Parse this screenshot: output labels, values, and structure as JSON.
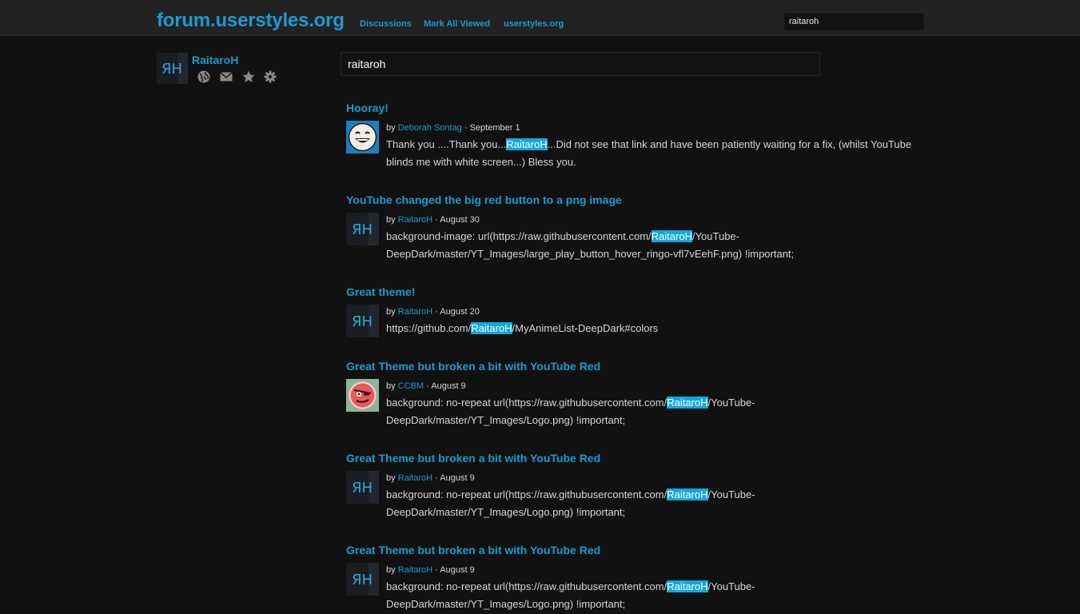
{
  "header": {
    "brand": "forum.userstyles.org",
    "nav": [
      "Discussions",
      "Mark All Viewed",
      "userstyles.org"
    ],
    "search_value": "raitaroh"
  },
  "profile": {
    "name": "RaitaroH",
    "avatar_text": "ЯH",
    "icons": [
      "globe-icon",
      "envelope-icon",
      "star-icon",
      "gear-icon"
    ]
  },
  "search": {
    "query": "raitaroh"
  },
  "results": [
    {
      "title": "Hooray!",
      "avatar": "smiley-avatar",
      "by": "by",
      "author": "Deborah Sontag",
      "date": "· September 1",
      "body_before": "Thank you ....Thank you...",
      "highlight": "RaitaroH",
      "body_after": "...Did not see that link and have been patiently waiting for a fix, (whilst YouTube blinds me with white screen...) Bless you."
    },
    {
      "title": "YouTube changed the big red button to a png image",
      "avatar": "raitaroh-avatar",
      "by": "by",
      "author": "RaitaroH",
      "date": "· August 30",
      "body_before": "background-image: url(https://raw.githubusercontent.com/",
      "highlight": "RaitaroH",
      "body_after": "/YouTube-DeepDark/master/YT_Images/large_play_button_hover_ringo-vfl7vEehF.png) !important;"
    },
    {
      "title": "Great theme!",
      "avatar": "raitaroh-avatar",
      "by": "by",
      "author": "RaitaroH",
      "date": "· August 20",
      "body_before": "https://github.com/",
      "highlight": "RaitaroH",
      "body_after": "/MyAnimeList-DeepDark#colors"
    },
    {
      "title": "Great Theme but broken a bit with YouTube Red",
      "avatar": "pirate-avatar",
      "by": "by",
      "author": "CCBM",
      "date": "· August 9",
      "body_before": "background: no-repeat url(https://raw.githubusercontent.com/",
      "highlight": "RaitaroH",
      "body_after": "/YouTube-DeepDark/master/YT_Images/Logo.png) !important;"
    },
    {
      "title": "Great Theme but broken a bit with YouTube Red",
      "avatar": "raitaroh-avatar",
      "by": "by",
      "author": "RaitaroH",
      "date": "· August 9",
      "body_before": "background: no-repeat url(https://raw.githubusercontent.com/",
      "highlight": "RaitaroH",
      "body_after": "/YouTube-DeepDark/master/YT_Images/Logo.png) !important;"
    },
    {
      "title": "Great Theme but broken a bit with YouTube Red",
      "avatar": "raitaroh-avatar",
      "by": "by",
      "author": "RaitaroH",
      "date": "· August 9",
      "body_before": "background: no-repeat url(https://raw.githubusercontent.com/",
      "highlight": "RaitaroH",
      "body_after": "/YouTube-DeepDark/master/YT_Images/Logo.png) !important;"
    }
  ],
  "colors": {
    "accent": "#1b9bd1",
    "highlight": "#12a8dd",
    "background": "#111111",
    "header": "#222222"
  }
}
